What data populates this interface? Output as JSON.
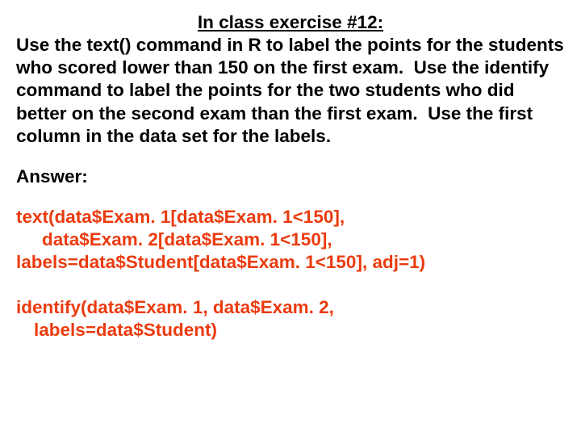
{
  "title": "In class exercise #12:",
  "prompt": "Use the text() command in R to label the points for the students who scored lower than 150 on the first exam.  Use the identify command to label the points for the two students who did better on the second exam than the first exam.  Use the first column in the data set for the labels.",
  "answer_label": "Answer:",
  "code1": {
    "l1": "text(data$Exam. 1[data$Exam. 1<150],",
    "l2": "data$Exam. 2[data$Exam. 1<150],",
    "l3": "labels=data$Student[data$Exam. 1<150], adj=1)"
  },
  "code2": {
    "l1": "identify(data$Exam. 1, data$Exam. 2,",
    "l2": "labels=data$Student)"
  }
}
